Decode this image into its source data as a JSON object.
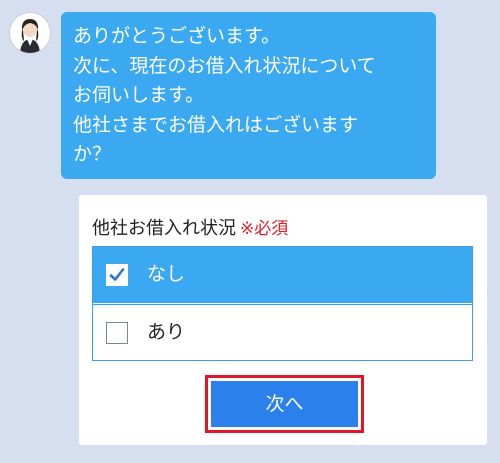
{
  "chat": {
    "avatar_icon": "operator-avatar-icon",
    "message_lines": [
      "ありがとうございます。",
      "次に、現在のお借入れ状況について",
      "お伺いします。",
      "他社さまでお借入れはございます",
      "か？"
    ]
  },
  "form": {
    "label": "他社お借入れ状況",
    "required_mark": "※必須",
    "options": [
      {
        "label": "なし",
        "checked": true
      },
      {
        "label": "あり",
        "checked": false
      }
    ],
    "next_label": "次へ"
  },
  "colors": {
    "background": "#d6dff0",
    "bubble": "#3aa9f1",
    "selected_option": "#3aa9f1",
    "button": "#2b80ec",
    "highlight_border": "#e0172b",
    "required": "#e0202a"
  }
}
